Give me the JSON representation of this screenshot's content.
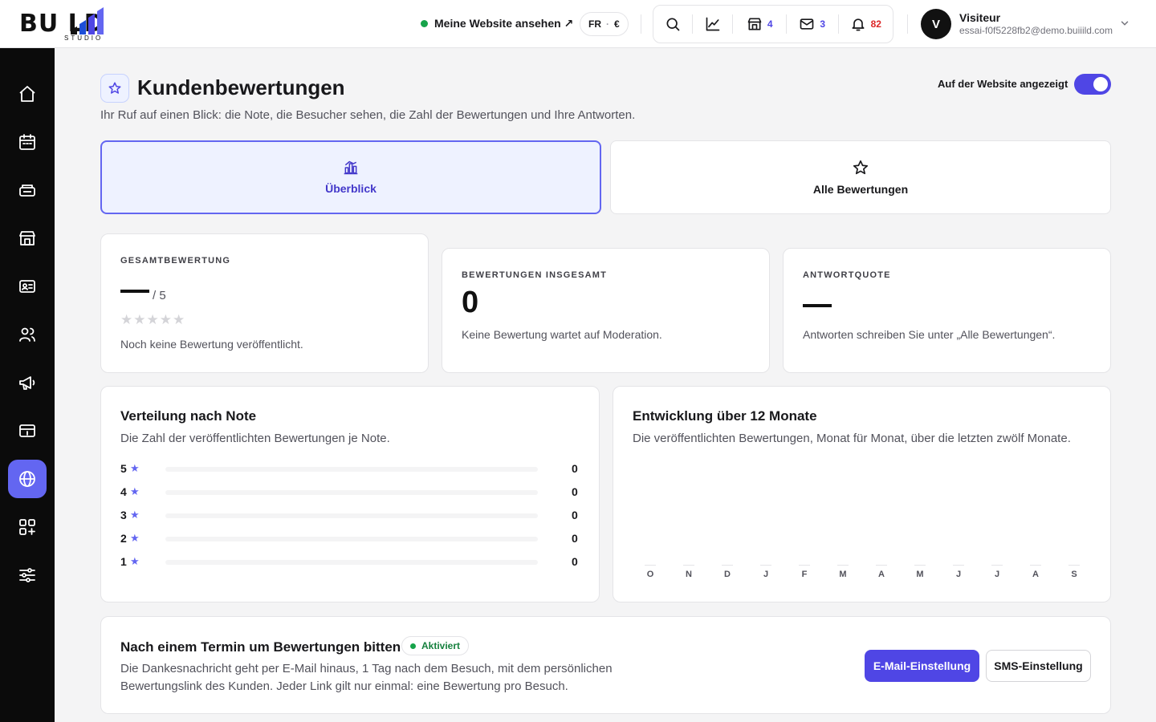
{
  "brand": {
    "logo_text": "BU  LD",
    "logo_sub": "STUDIO"
  },
  "header": {
    "site_link": "Meine Website ansehen ↗",
    "lang": "FR",
    "currency": "€",
    "counts": {
      "shop": "4",
      "mail": "3",
      "notifications": "82"
    },
    "user": {
      "initial": "V",
      "name": "Visiteur",
      "email": "essai-f0f5228fb2@demo.buiiild.com"
    }
  },
  "page": {
    "title": "Kundenbewertungen",
    "subtitle": "Ihr Ruf auf einen Blick: die Note, die Besucher sehen, die Zahl der Bewertungen und Ihre Antworten.",
    "toggle_label": "Auf der Website angezeigt",
    "toggle_on": true
  },
  "tabs": [
    {
      "label": "Überblick",
      "active": true
    },
    {
      "label": "Alle Bewertungen",
      "active": false
    }
  ],
  "stats": {
    "overall": {
      "label": "GESAMTBEWERTUNG",
      "of": "/ 5",
      "stars": "★★★★★",
      "note": "Noch keine Bewertung veröffentlicht."
    },
    "total": {
      "label": "BEWERTUNGEN INSGESAMT",
      "value": "0",
      "note": "Keine Bewertung wartet auf Moderation."
    },
    "response": {
      "label": "ANTWORTQUOTE",
      "note": "Antworten schreiben Sie unter „Alle Bewertungen“."
    }
  },
  "distribution": {
    "title": "Verteilung nach Note",
    "desc": "Die Zahl der veröffentlichten Bewertungen je Note.",
    "rows": [
      {
        "grade": "5",
        "count": "0",
        "fraction": 0
      },
      {
        "grade": "4",
        "count": "0",
        "fraction": 0
      },
      {
        "grade": "3",
        "count": "0",
        "fraction": 0
      },
      {
        "grade": "2",
        "count": "0",
        "fraction": 0
      },
      {
        "grade": "1",
        "count": "0",
        "fraction": 0
      }
    ]
  },
  "trend": {
    "title": "Entwicklung über 12 Monate",
    "desc": "Die veröffentlichten Bewertungen, Monat für Monat, über die letzten zwölf Monate.",
    "months": [
      "O",
      "N",
      "D",
      "J",
      "F",
      "M",
      "A",
      "M",
      "J",
      "J",
      "A",
      "S"
    ]
  },
  "cta": {
    "title": "Nach einem Termin um Bewertungen bitten",
    "badge": "Aktiviert",
    "desc": "Die Dankesnachricht geht per E-Mail hinaus, 1 Tag nach dem Besuch, mit dem persönlichen Bewertungslink des Kunden. Jeder Link gilt nur einmal: eine Bewertung pro Besuch.",
    "primary": "E-Mail-Einstellung",
    "secondary": "SMS-Einstellung"
  },
  "colors": {
    "accent": "#4f46e5",
    "accent_light": "#6366f1",
    "success": "#16a34a",
    "danger": "#dc2626"
  },
  "icons": [
    "home-icon",
    "calendar-icon",
    "services-icon",
    "store-icon",
    "contact-card-icon",
    "users-icon",
    "megaphone-icon",
    "billing-icon",
    "globe-icon",
    "apps-icon",
    "settings-sliders-icon"
  ]
}
